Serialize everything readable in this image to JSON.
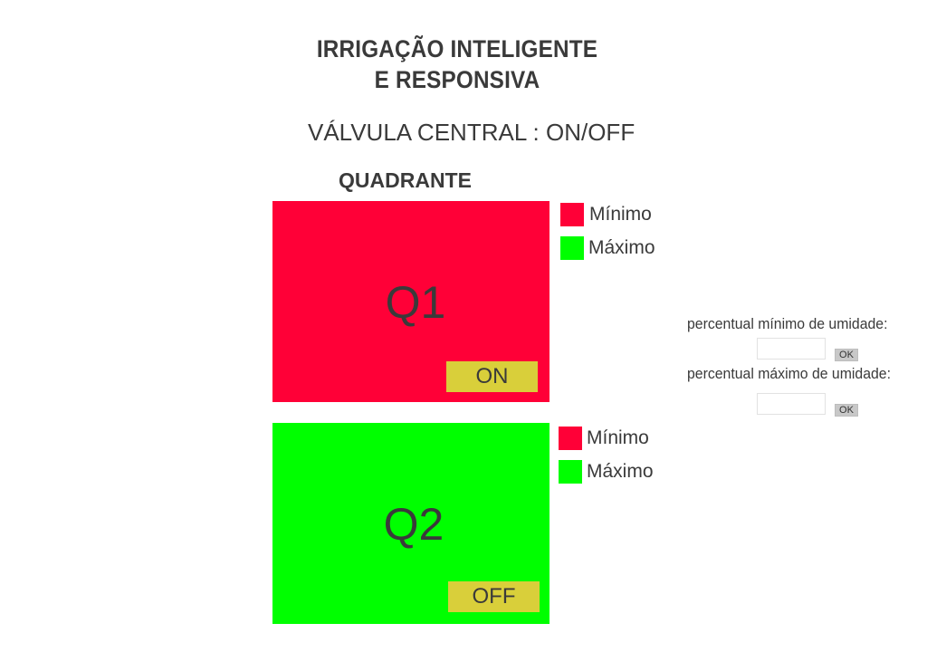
{
  "header": {
    "title_line1": "IRRIGAÇÃO  INTELIGENTE",
    "title_line2": "E RESPONSIVA",
    "valve_status": "VÁLVULA CENTRAL : ON/OFF",
    "section_heading": "QUADRANTE"
  },
  "colors": {
    "minimum": "#ff0037",
    "maximum": "#00ff00",
    "button": "#d9cf3a"
  },
  "quadrants": [
    {
      "label": "Q1",
      "state": "ON",
      "color": "#ff0037",
      "legend": {
        "min_label": "Mínimo",
        "max_label": "Máximo"
      }
    },
    {
      "label": "Q2",
      "state": "OFF",
      "color": "#00ff00",
      "legend": {
        "min_label": "Mínimo",
        "max_label": "Máximo"
      }
    }
  ],
  "settings": {
    "min_humidity_label": "percentual mínimo de umidade:",
    "min_humidity_value": "",
    "min_ok_label": "OK",
    "max_humidity_label": "percentual máximo de umidade:",
    "max_humidity_value": "",
    "max_ok_label": "OK"
  }
}
